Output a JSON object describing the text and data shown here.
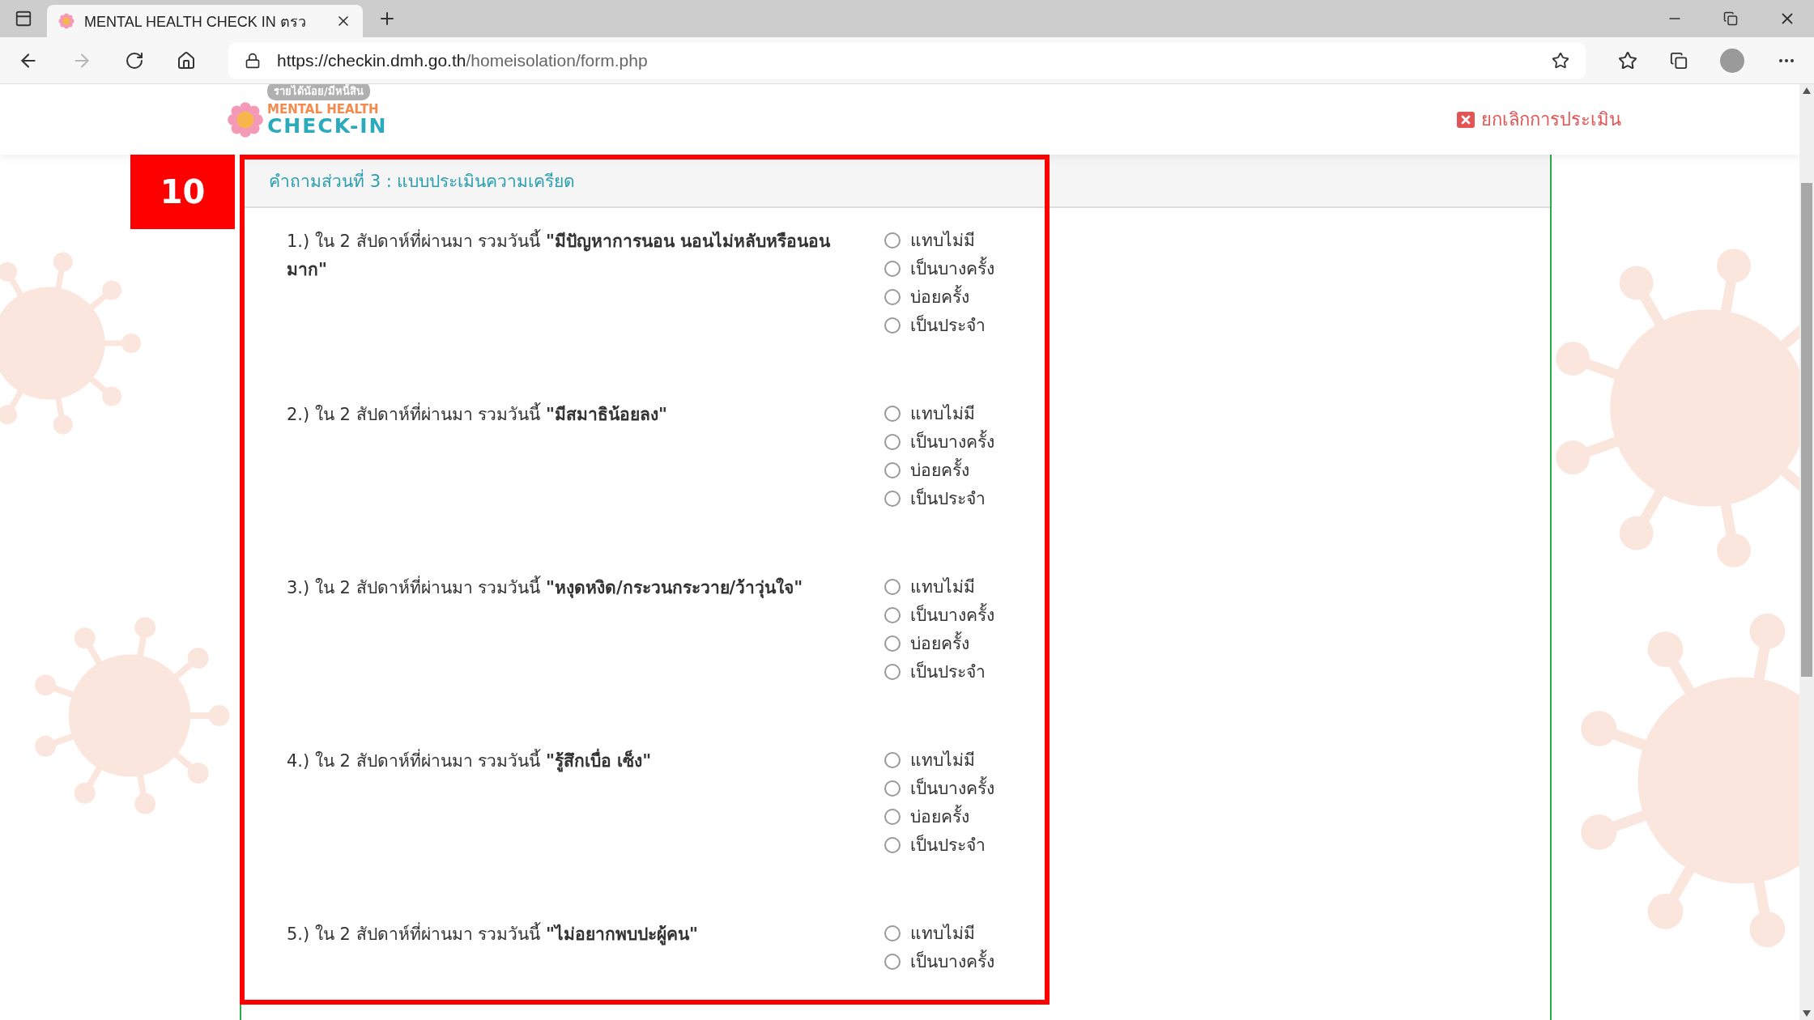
{
  "browser": {
    "tab": {
      "title": "MENTAL HEALTH CHECK IN ตรว",
      "selected": true
    },
    "url": {
      "host": "https://checkin.dmh.go.th",
      "path": "/homeisolation/form.php"
    }
  },
  "header": {
    "tag": "รายได้น้อย/มีหนี้สิน",
    "logo": {
      "line_1": "MENTAL HEALTH",
      "line_2": "CHECK-IN"
    },
    "cancel_link": "ยกเลิกการประเมิน"
  },
  "step_badge": "10",
  "section": {
    "title": "คำถามส่วนที่ 3 : แบบประเมินความเครียด",
    "questions": [
      {
        "text": "1.) ใน 2 สัปดาห์ที่ผ่านมา รวมวันนี้ **\"มีปัญหาการนอน นอนไม่หลับหรือนอนมาก\"**",
        "options": [
          {
            "label": "แทบไม่มี",
            "selected": false
          },
          {
            "label": "เป็นบางครั้ง",
            "selected": false
          },
          {
            "label": "บ่อยครั้ง",
            "selected": false
          },
          {
            "label": "เป็นประจำ",
            "selected": false
          }
        ]
      },
      {
        "text": "2.) ใน 2 สัปดาห์ที่ผ่านมา รวมวันนี้ **\"มีสมาธิน้อยลง\"**",
        "options": [
          {
            "label": "แทบไม่มี",
            "selected": false
          },
          {
            "label": "เป็นบางครั้ง",
            "selected": false
          },
          {
            "label": "บ่อยครั้ง",
            "selected": false
          },
          {
            "label": "เป็นประจำ",
            "selected": false
          }
        ]
      },
      {
        "text": "3.) ใน 2 สัปดาห์ที่ผ่านมา รวมวันนี้ **\"หงุดหงิด/กระวนกระวาย/ว้าวุ่นใจ\"**",
        "options": [
          {
            "label": "แทบไม่มี",
            "selected": false
          },
          {
            "label": "เป็นบางครั้ง",
            "selected": false
          },
          {
            "label": "บ่อยครั้ง",
            "selected": false
          },
          {
            "label": "เป็นประจำ",
            "selected": false
          }
        ]
      },
      {
        "text": "4.) ใน 2 สัปดาห์ที่ผ่านมา รวมวันนี้ **\"รู้สึกเบื่อ เซ็ง\"**",
        "options": [
          {
            "label": "แทบไม่มี",
            "selected": false
          },
          {
            "label": "เป็นบางครั้ง",
            "selected": false
          },
          {
            "label": "บ่อยครั้ง",
            "selected": false
          },
          {
            "label": "เป็นประจำ",
            "selected": false
          }
        ]
      },
      {
        "text": "5.) ใน 2 สัปดาห์ที่ผ่านมา รวมวันนี้ **\"ไม่อยากพบปะผู้คน\"**",
        "options": [
          {
            "label": "แทบไม่มี",
            "selected": false
          },
          {
            "label": "เป็นบางครั้ง",
            "selected": false
          }
        ]
      }
    ]
  }
}
